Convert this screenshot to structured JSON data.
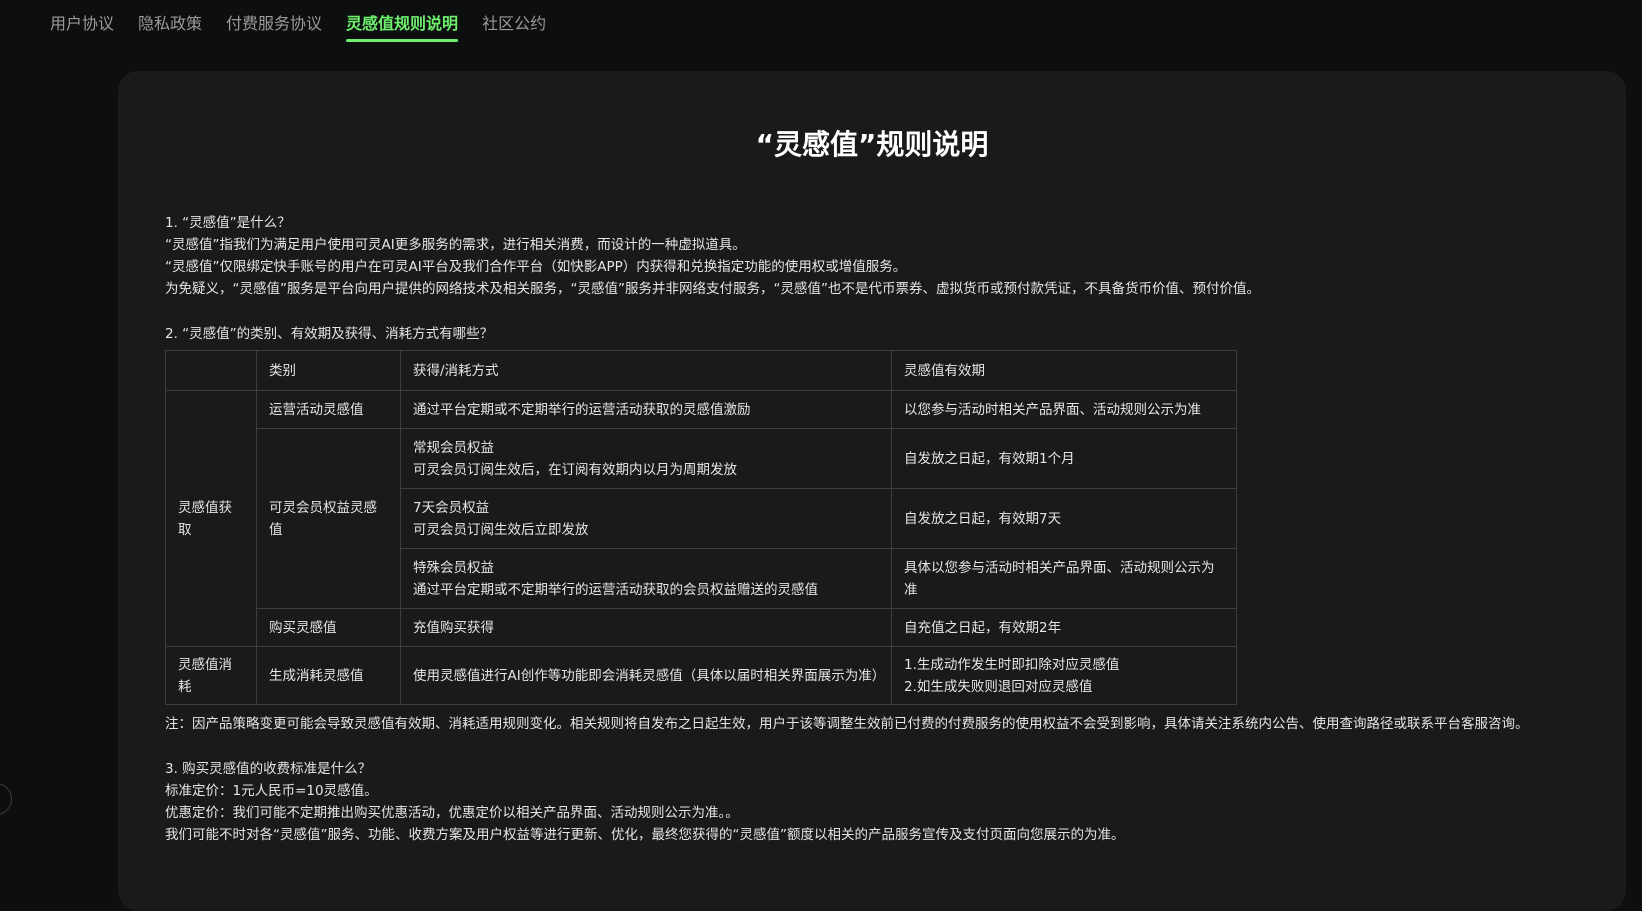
{
  "tabs": [
    {
      "label": "用户协议",
      "active": false
    },
    {
      "label": "隐私政策",
      "active": false
    },
    {
      "label": "付费服务协议",
      "active": false
    },
    {
      "label": "灵感值规则说明",
      "active": true
    },
    {
      "label": "社区公约",
      "active": false
    }
  ],
  "page_title": "“灵感值”规则说明",
  "section1": {
    "heading": "1. “灵感值”是什么？",
    "lines": [
      "“灵感值”指我们为满足用户使用可灵AI更多服务的需求，进行相关消费，而设计的一种虚拟道具。",
      "“灵感值”仅限绑定快手账号的用户在可灵AI平台及我们合作平台（如快影APP）内获得和兑换指定功能的使用权或增值服务。",
      "为免疑义，“灵感值”服务是平台向用户提供的网络技术及相关服务，“灵感值”服务并非网络支付服务，“灵感值”也不是代币票券、虚拟货币或预付款凭证，不具备货币价值、预付价值。"
    ]
  },
  "section2": {
    "heading": "2. “灵感值”的类别、有效期及获得、消耗方式有哪些？",
    "table": {
      "headers": [
        "",
        "类别",
        "获得/消耗方式",
        "灵感值有效期"
      ],
      "group_acquire": "灵感值获取",
      "group_consume": "灵感值消耗",
      "rows": {
        "ops": {
          "category": "运营活动灵感值",
          "method": "通过平台定期或不定期举行的运营活动获取的灵感值激励",
          "validity": "以您参与活动时相关产品界面、活动规则公示为准"
        },
        "member_category": "可灵会员权益灵感值",
        "member_regular": {
          "method_title": "常规会员权益",
          "method_desc": "可灵会员订阅生效后，在订阅有效期内以月为周期发放",
          "validity": "自发放之日起，有效期1个月"
        },
        "member_7day": {
          "method_title": "7天会员权益",
          "method_desc": "可灵会员订阅生效后立即发放",
          "validity": "自发放之日起，有效期7天"
        },
        "member_special": {
          "method_title": "特殊会员权益",
          "method_desc": "通过平台定期或不定期举行的运营活动获取的会员权益赠送的灵感值",
          "validity": "具体以您参与活动时相关产品界面、活动规则公示为准"
        },
        "purchase": {
          "category": "购买灵感值",
          "method": "充值购买获得",
          "validity": "自充值之日起，有效期2年"
        },
        "generate": {
          "category": "生成消耗灵感值",
          "method": "使用灵感值进行AI创作等功能即会消耗灵感值（具体以届时相关界面展示为准）",
          "validity_1": "1.生成动作发生时即扣除对应灵感值",
          "validity_2": "2.如生成失败则退回对应灵感值"
        }
      }
    },
    "note": "注：因产品策略变更可能会导致灵感值有效期、消耗适用规则变化。相关规则将自发布之日起生效，用户于该等调整生效前已付费的付费服务的使用权益不会受到影响，具体请关注系统内公告、使用查询路径或联系平台客服咨询。"
  },
  "section3": {
    "heading": "3. 购买灵感值的收费标准是什么？",
    "lines": [
      "标准定价：1元人民币=10灵感值。",
      "优惠定价：我们可能不定期推出购买优惠活动，优惠定价以相关产品界面、活动规则公示为准。。",
      "我们可能不时对各“灵感值”服务、功能、收费方案及用户权益等进行更新、优化，最终您获得的“灵感值”额度以相关的产品服务宣传及支付页面向您展示的为准。"
    ]
  },
  "colors": {
    "background": "#0d0e0e",
    "card": "#191a1b",
    "accent": "#6ef06e",
    "border": "#3c3d3f"
  }
}
